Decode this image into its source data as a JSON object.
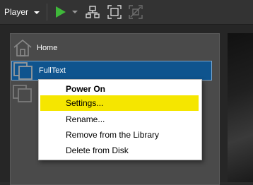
{
  "toolbar": {
    "player_label": "Player"
  },
  "library": {
    "items": [
      {
        "label": "Home"
      },
      {
        "label": "FullText"
      },
      {
        "label": ""
      }
    ]
  },
  "context_menu": {
    "items": [
      {
        "label": "Power On",
        "bold": true
      },
      {
        "label": "Settings...",
        "highlighted": true
      },
      {
        "label": "Rename..."
      },
      {
        "label": "Remove from the Library"
      },
      {
        "label": "Delete from Disk"
      }
    ]
  },
  "colors": {
    "accent_green": "#3fb83a",
    "selection_blue": "#0f548e",
    "highlight_yellow": "#f5e600"
  }
}
